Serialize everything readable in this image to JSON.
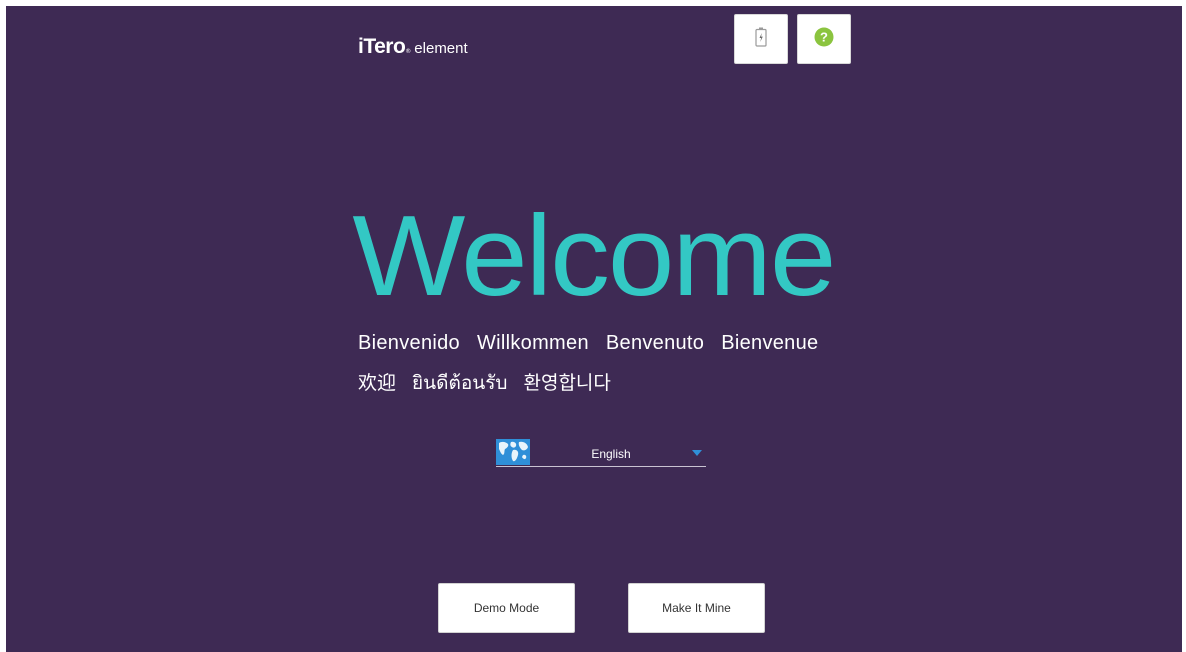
{
  "header": {
    "logo_brand": "iTero",
    "logo_reg": "®",
    "logo_sub": "element",
    "icons": {
      "battery": "battery-icon",
      "help": "help-icon"
    }
  },
  "main": {
    "welcome_title": "Welcome",
    "greetings_row1": [
      "Bienvenido",
      "Willkommen",
      "Benvenuto",
      "Bienvenue"
    ],
    "greetings_row2": [
      "欢迎",
      "ยินดีต้อนรับ",
      "환영합니다"
    ]
  },
  "language_select": {
    "icon": "globe-icon",
    "selected_value": "English"
  },
  "actions": {
    "demo_mode_label": "Demo Mode",
    "make_it_mine_label": "Make It Mine"
  },
  "colors": {
    "background": "#3e2a54",
    "accent_teal": "#33c8c4",
    "accent_blue": "#2f8fd8",
    "help_green": "#8bc43f"
  }
}
